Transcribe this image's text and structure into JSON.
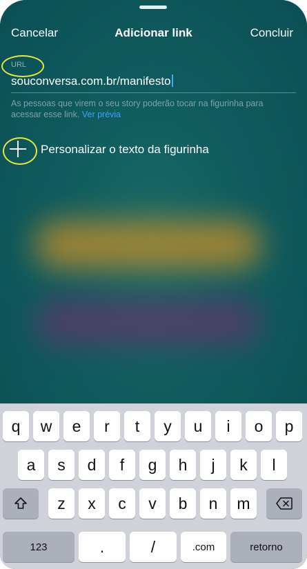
{
  "nav": {
    "cancel": "Cancelar",
    "title": "Adicionar link",
    "done": "Concluir"
  },
  "url_field": {
    "label": "URL",
    "value": "souconversa.com.br/manifesto",
    "helper": "As pessoas que virem o seu story poderão tocar na figurinha para acessar esse link.",
    "helper_link": "Ver prévia"
  },
  "customize": {
    "label": "Personalizar o texto da figurinha",
    "icon": "plus-icon"
  },
  "keyboard": {
    "row1": [
      "q",
      "w",
      "e",
      "r",
      "t",
      "y",
      "u",
      "i",
      "o",
      "p"
    ],
    "row2": [
      "a",
      "s",
      "d",
      "f",
      "g",
      "h",
      "j",
      "k",
      "l"
    ],
    "row3": [
      "z",
      "x",
      "c",
      "v",
      "b",
      "n",
      "m"
    ],
    "shift_icon": "shift-icon",
    "delete_icon": "delete-icon",
    "numbers": "123",
    "period": ".",
    "slash": "/",
    "dotcom": ".com",
    "return": "retorno"
  },
  "colors": {
    "accent": "#3aa3ff",
    "annotation": "#e8e83a",
    "background": "#0f5b5e"
  }
}
